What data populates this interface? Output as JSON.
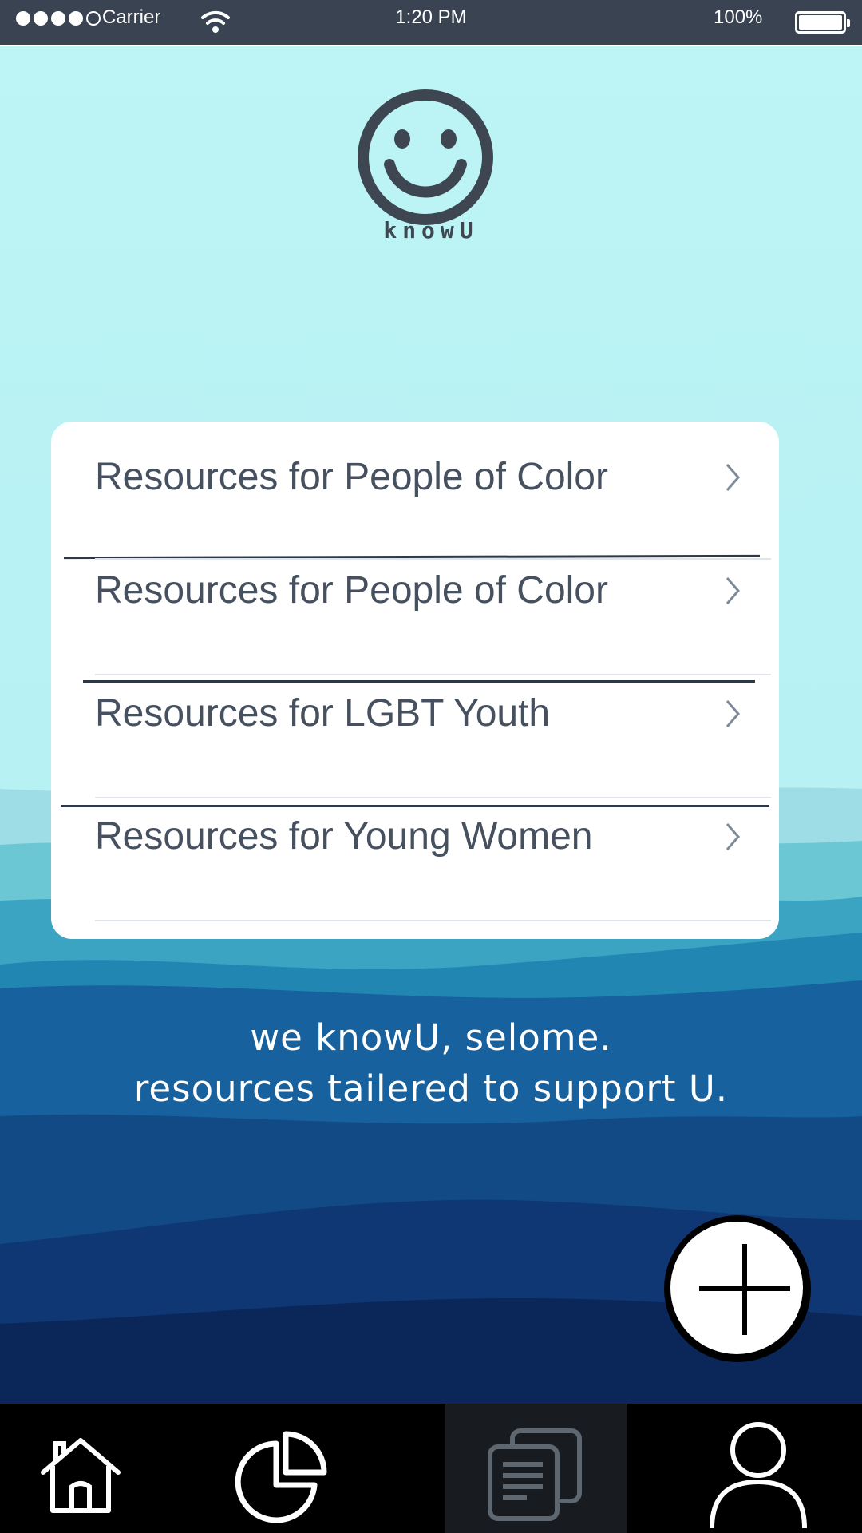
{
  "status_bar": {
    "carrier": "Carrier",
    "time": "1:20 PM",
    "battery": "100%",
    "signal_icon": "signal-dots-icon",
    "wifi_icon": "wifi-icon",
    "battery_icon": "battery-icon"
  },
  "logo": {
    "icon": "smiley-face-icon",
    "text": "knowU"
  },
  "resources": [
    {
      "label": "Resources for People of Color",
      "icon": "chevron-right-icon"
    },
    {
      "label": "Resources for People of Color",
      "icon": "chevron-right-icon"
    },
    {
      "label": "Resources for LGBT Youth",
      "icon": "chevron-right-icon"
    },
    {
      "label": "Resources for Young Women",
      "icon": "chevron-right-icon"
    }
  ],
  "message": {
    "line1": "we knowU, selome.",
    "line2": "resources tailered to support U."
  },
  "fab": {
    "icon": "plus-icon"
  },
  "bottom_nav": [
    {
      "name": "home",
      "icon": "home-icon",
      "active": false
    },
    {
      "name": "stats",
      "icon": "pie-chart-icon",
      "active": false
    },
    {
      "name": "resources",
      "icon": "documents-icon",
      "active": true
    },
    {
      "name": "profile",
      "icon": "person-icon",
      "active": false
    }
  ],
  "colors": {
    "status_bar": "#3a4352",
    "sky": "#bff5f6",
    "deep_blue": "#0c2350",
    "text_dark": "#46505e"
  }
}
